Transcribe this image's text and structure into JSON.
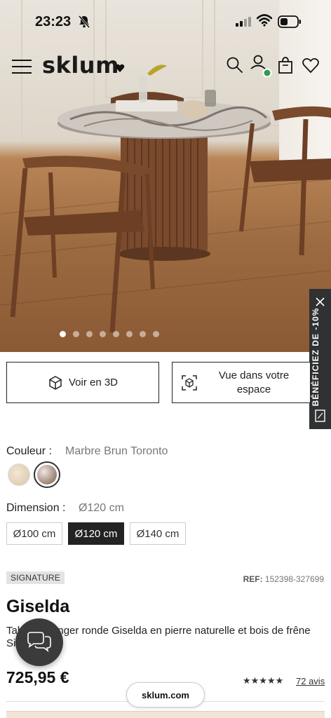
{
  "status": {
    "time": "23:23"
  },
  "header": {
    "logo": "sklum"
  },
  "carousel": {
    "dots": 8,
    "active": 0
  },
  "promo": {
    "text": "BÉNÉFICIEZ DE -10%"
  },
  "actions": {
    "view_3d": "Voir en 3D",
    "view_space_line1": "Vue dans votre",
    "view_space_line2": "espace"
  },
  "color": {
    "label": "Couleur :",
    "value": "Marbre Brun Toronto"
  },
  "dimension": {
    "label": "Dimension :",
    "value": "Ø120 cm",
    "options": [
      "Ø100 cm",
      "Ø120 cm",
      "Ø140 cm"
    ]
  },
  "product": {
    "badge": "SIGNATURE",
    "ref_label": "REF:",
    "ref_value": "152398-327699",
    "title": "Giselda",
    "description": "Table à manger ronde Giselda en pierre naturelle et bois de frêne Sier",
    "price": "725,95 €",
    "stars": "★★★★★",
    "reviews": "72 avis"
  },
  "browser": {
    "url": "sklum.com"
  },
  "colors": {
    "accent_dark": "#232323",
    "promo_bg": "#2f3133",
    "online_dot": "#2e9b4f"
  },
  "icons": [
    "bell-off-icon",
    "signal-icon",
    "wifi-icon",
    "battery-icon",
    "hamburger-icon",
    "heart-icon",
    "search-icon",
    "user-icon",
    "bag-icon",
    "wishlist-heart-icon",
    "close-icon",
    "discount-tag-icon",
    "cube-3d-icon",
    "ar-cube-icon",
    "chat-icon"
  ]
}
